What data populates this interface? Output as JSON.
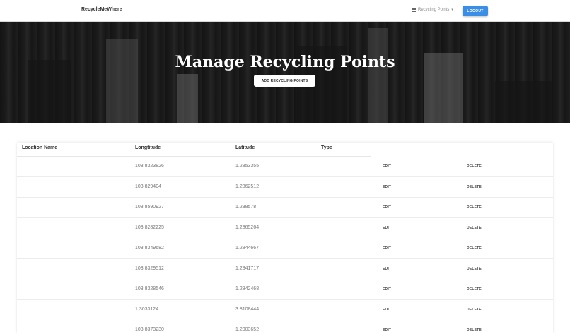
{
  "navbar": {
    "brand": "RecycleMeWhere",
    "dropdown_label": "Recycling Points",
    "logout_label": "LOGOUT"
  },
  "hero": {
    "title": "Manage Recycling Points",
    "add_button_label": "ADD RECYCLING POINTS"
  },
  "table": {
    "headers": [
      "Location Name",
      "Longtitude",
      "Latitude",
      "Type"
    ],
    "edit_label": "EDIT",
    "delete_label": "DELETE",
    "rows": [
      {
        "name": "",
        "lng": "103.8323826",
        "lat": "1.2853355",
        "type": ""
      },
      {
        "name": "",
        "lng": "103.829404",
        "lat": "1.2862512",
        "type": ""
      },
      {
        "name": "",
        "lng": "103.8590927",
        "lat": "1.238578",
        "type": ""
      },
      {
        "name": "",
        "lng": "103.8282225",
        "lat": "1.2865264",
        "type": ""
      },
      {
        "name": "",
        "lng": "103.8349682",
        "lat": "1.2844667",
        "type": ""
      },
      {
        "name": "",
        "lng": "103.8329512",
        "lat": "1.2841717",
        "type": ""
      },
      {
        "name": "",
        "lng": "103.8328546",
        "lat": "1.2842468",
        "type": ""
      },
      {
        "name": "",
        "lng": "1.3033124",
        "lat": "3.8108444",
        "type": ""
      },
      {
        "name": "",
        "lng": "103.8373230",
        "lat": "1.2003652",
        "type": ""
      }
    ]
  },
  "colors": {
    "accent": "#3a8ee6",
    "hero_bg": "#262626"
  },
  "icons": {
    "dropdown_icon": "grid-icon",
    "caret": "chevron-down-icon"
  }
}
